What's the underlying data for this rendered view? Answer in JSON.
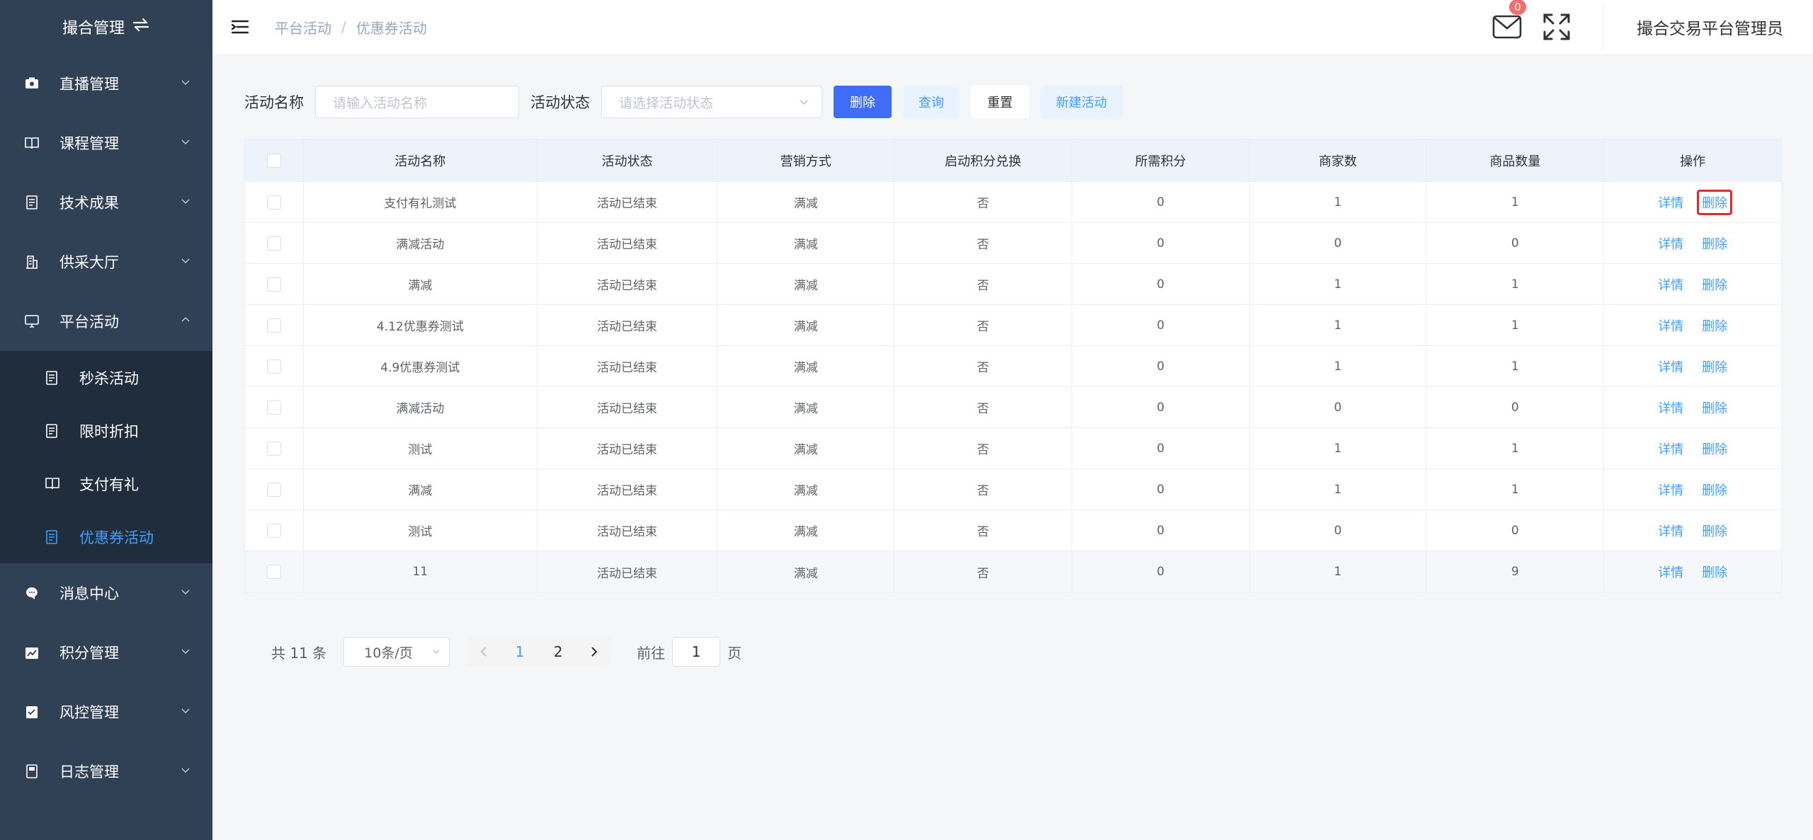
{
  "sidebar": {
    "logo_title": "撮合管理",
    "logo_icon": "swap-icon",
    "menu_before": [
      {
        "label": "直播管理",
        "icon": "video-icon"
      },
      {
        "label": "课程管理",
        "icon": "book-icon"
      },
      {
        "label": "技术成果",
        "icon": "document-icon"
      },
      {
        "label": "供采大厅",
        "icon": "building-icon"
      },
      {
        "label": "平台活动",
        "icon": "monitor-icon"
      }
    ],
    "submenu": [
      {
        "label": "秒杀活动",
        "icon": "document-icon"
      },
      {
        "label": "限时折扣",
        "icon": "document-icon"
      },
      {
        "label": "支付有礼",
        "icon": "book-icon"
      },
      {
        "label": "优惠券活动",
        "icon": "document-icon",
        "active": true
      }
    ],
    "menu_after": [
      {
        "label": "消息中心",
        "icon": "chat-icon"
      },
      {
        "label": "积分管理",
        "icon": "chart-icon"
      },
      {
        "label": "风控管理",
        "icon": "checklist-icon"
      },
      {
        "label": "日志管理",
        "icon": "log-icon"
      }
    ]
  },
  "header": {
    "breadcrumb": [
      "平台活动",
      "优惠券活动"
    ],
    "mail_badge": "0",
    "admin_name": "撮合交易平台管理员"
  },
  "filter": {
    "name_label": "活动名称",
    "name_placeholder": "请输入活动名称",
    "status_label": "活动状态",
    "status_placeholder": "请选择活动状态",
    "btn_delete": "删除",
    "btn_query": "查询",
    "btn_reset": "重置",
    "btn_new": "新建活动"
  },
  "table": {
    "columns": [
      "活动名称",
      "活动状态",
      "营销方式",
      "启动积分兑换",
      "所需积分",
      "商家数",
      "商品数量",
      "操作"
    ],
    "action_detail": "详情",
    "action_delete": "删除",
    "rows": [
      [
        "支付有礼测试",
        "活动已结束",
        "满减",
        "否",
        "0",
        "1",
        "1"
      ],
      [
        "满减活动",
        "活动已结束",
        "满减",
        "否",
        "0",
        "0",
        "0"
      ],
      [
        "满减",
        "活动已结束",
        "满减",
        "否",
        "0",
        "1",
        "1"
      ],
      [
        "4.12优惠券测试",
        "活动已结束",
        "满减",
        "否",
        "0",
        "1",
        "1"
      ],
      [
        "4.9优惠券测试",
        "活动已结束",
        "满减",
        "否",
        "0",
        "1",
        "1"
      ],
      [
        "满减活动",
        "活动已结束",
        "满减",
        "否",
        "0",
        "0",
        "0"
      ],
      [
        "测试",
        "活动已结束",
        "满减",
        "否",
        "0",
        "1",
        "1"
      ],
      [
        "满减",
        "活动已结束",
        "满减",
        "否",
        "0",
        "1",
        "1"
      ],
      [
        "测试",
        "活动已结束",
        "满减",
        "否",
        "0",
        "0",
        "0"
      ],
      [
        "11",
        "活动已结束",
        "满减",
        "否",
        "0",
        "1",
        "9"
      ]
    ]
  },
  "pagination": {
    "total": "共 11 条",
    "page_size": "10条/页",
    "pages": [
      "1",
      "2"
    ],
    "current": "1",
    "jump_label": "前往",
    "jump_value": "1",
    "jump_suffix": "页"
  }
}
